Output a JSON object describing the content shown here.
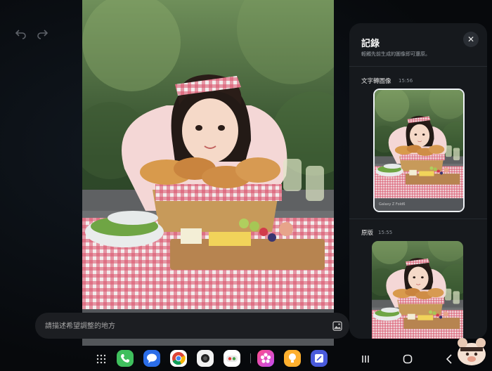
{
  "toolbar": {
    "undo_icon": "undo-icon",
    "redo_icon": "redo-icon"
  },
  "prompt": {
    "placeholder": "請描述希望調整的地方",
    "image_icon": "image-icon"
  },
  "history_panel": {
    "title": "記錄",
    "subtitle": "輕觸先前生成的圖像即可還原。",
    "close_icon": "close-icon",
    "sections": [
      {
        "label": "文字轉圖像",
        "time": "15:56",
        "watermark": "Galaxy Z Fold6"
      },
      {
        "label": "原版",
        "time": "15:55"
      }
    ]
  },
  "taskbar": {
    "apps": [
      "apps-grid-icon",
      "phone-icon",
      "messages-icon",
      "chrome-icon",
      "camera-icon",
      "game-launcher-icon",
      "gallery-icon",
      "tips-icon",
      "notes-icon"
    ],
    "nav": [
      "recents-icon",
      "home-icon",
      "back-icon"
    ]
  }
}
